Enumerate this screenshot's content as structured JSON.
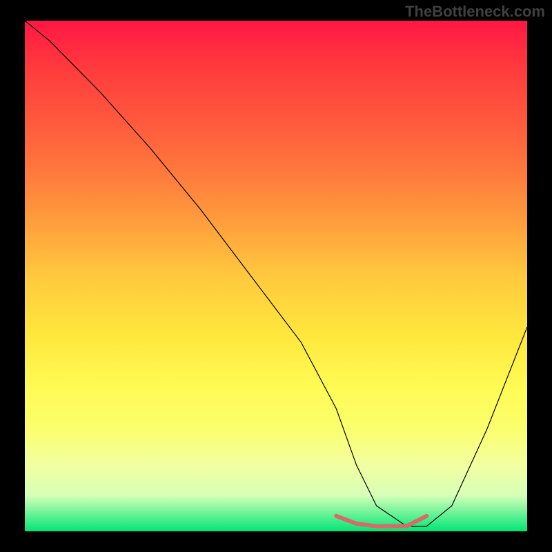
{
  "watermark": "TheBottleneck.com",
  "chart_data": {
    "type": "line",
    "title": "",
    "xlabel": "",
    "ylabel": "",
    "xlim": [
      0,
      100
    ],
    "ylim": [
      0,
      100
    ],
    "background_gradient": {
      "top": "#ff1744",
      "middle": "#ffe83d",
      "bottom": "#00e676"
    },
    "series": [
      {
        "name": "main-curve",
        "color": "#000000",
        "x": [
          0,
          5,
          8,
          15,
          25,
          35,
          45,
          55,
          62,
          66,
          70,
          76,
          80,
          85,
          92,
          100
        ],
        "values": [
          100,
          96,
          93,
          86,
          75,
          63,
          50,
          37,
          24,
          13,
          5,
          1,
          1,
          5,
          20,
          40
        ]
      },
      {
        "name": "red-marker-segment",
        "color": "#e06666",
        "x": [
          62,
          66,
          70,
          76,
          80
        ],
        "values": [
          3,
          1.5,
          1,
          1,
          3
        ]
      }
    ]
  }
}
